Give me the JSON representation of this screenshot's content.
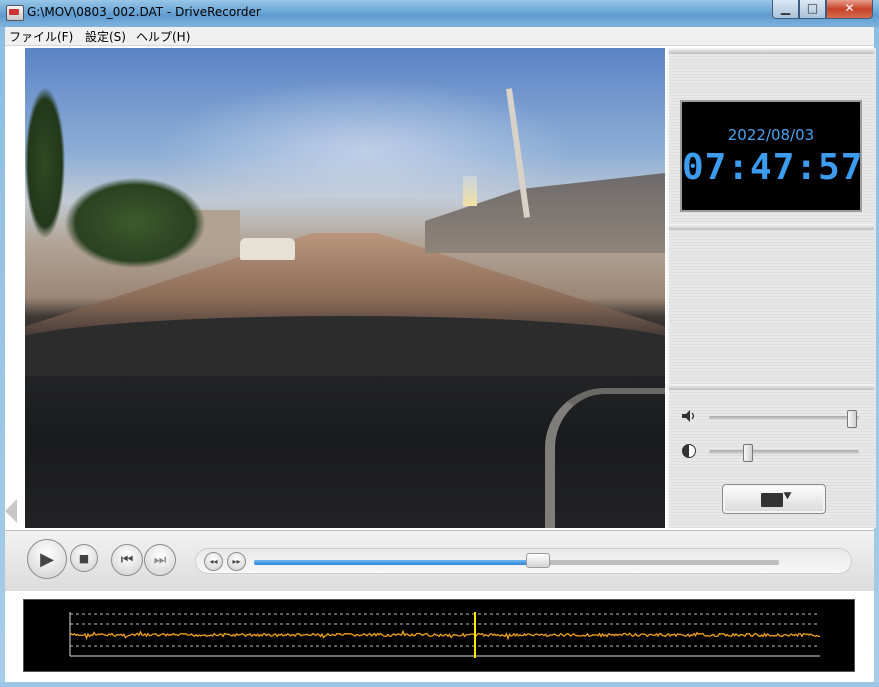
{
  "window": {
    "title": "G:\\MOV\\0803_002.DAT - DriveRecorder",
    "minimize_glyph": "▁",
    "maximize_glyph": "□",
    "close_glyph": "✕"
  },
  "menu": {
    "items": [
      {
        "label": "ファイル(F)"
      },
      {
        "label": "設定(S)"
      },
      {
        "label": "ヘルプ(H)"
      }
    ]
  },
  "clock": {
    "date": "2022/08/03",
    "time": "07:47:57",
    "color": "#3b9cf0"
  },
  "controls": {
    "volume_level": 0.97,
    "brightness_level": 0.24,
    "playback_position": 0.54,
    "play_glyph": "▶",
    "stop_glyph": "■",
    "prev_glyph": "⏮",
    "next_glyph": "⏭",
    "rewind_glyph": "◂◂",
    "forward_glyph": "▸▸"
  },
  "graph": {
    "trace_color": "#f0a020",
    "cursor_color": "#ffe600",
    "grid_color": "#bbbbbb"
  },
  "icons": {
    "speaker": "speaker-icon",
    "contrast": "contrast-icon",
    "open_folder": "open-folder-icon"
  }
}
